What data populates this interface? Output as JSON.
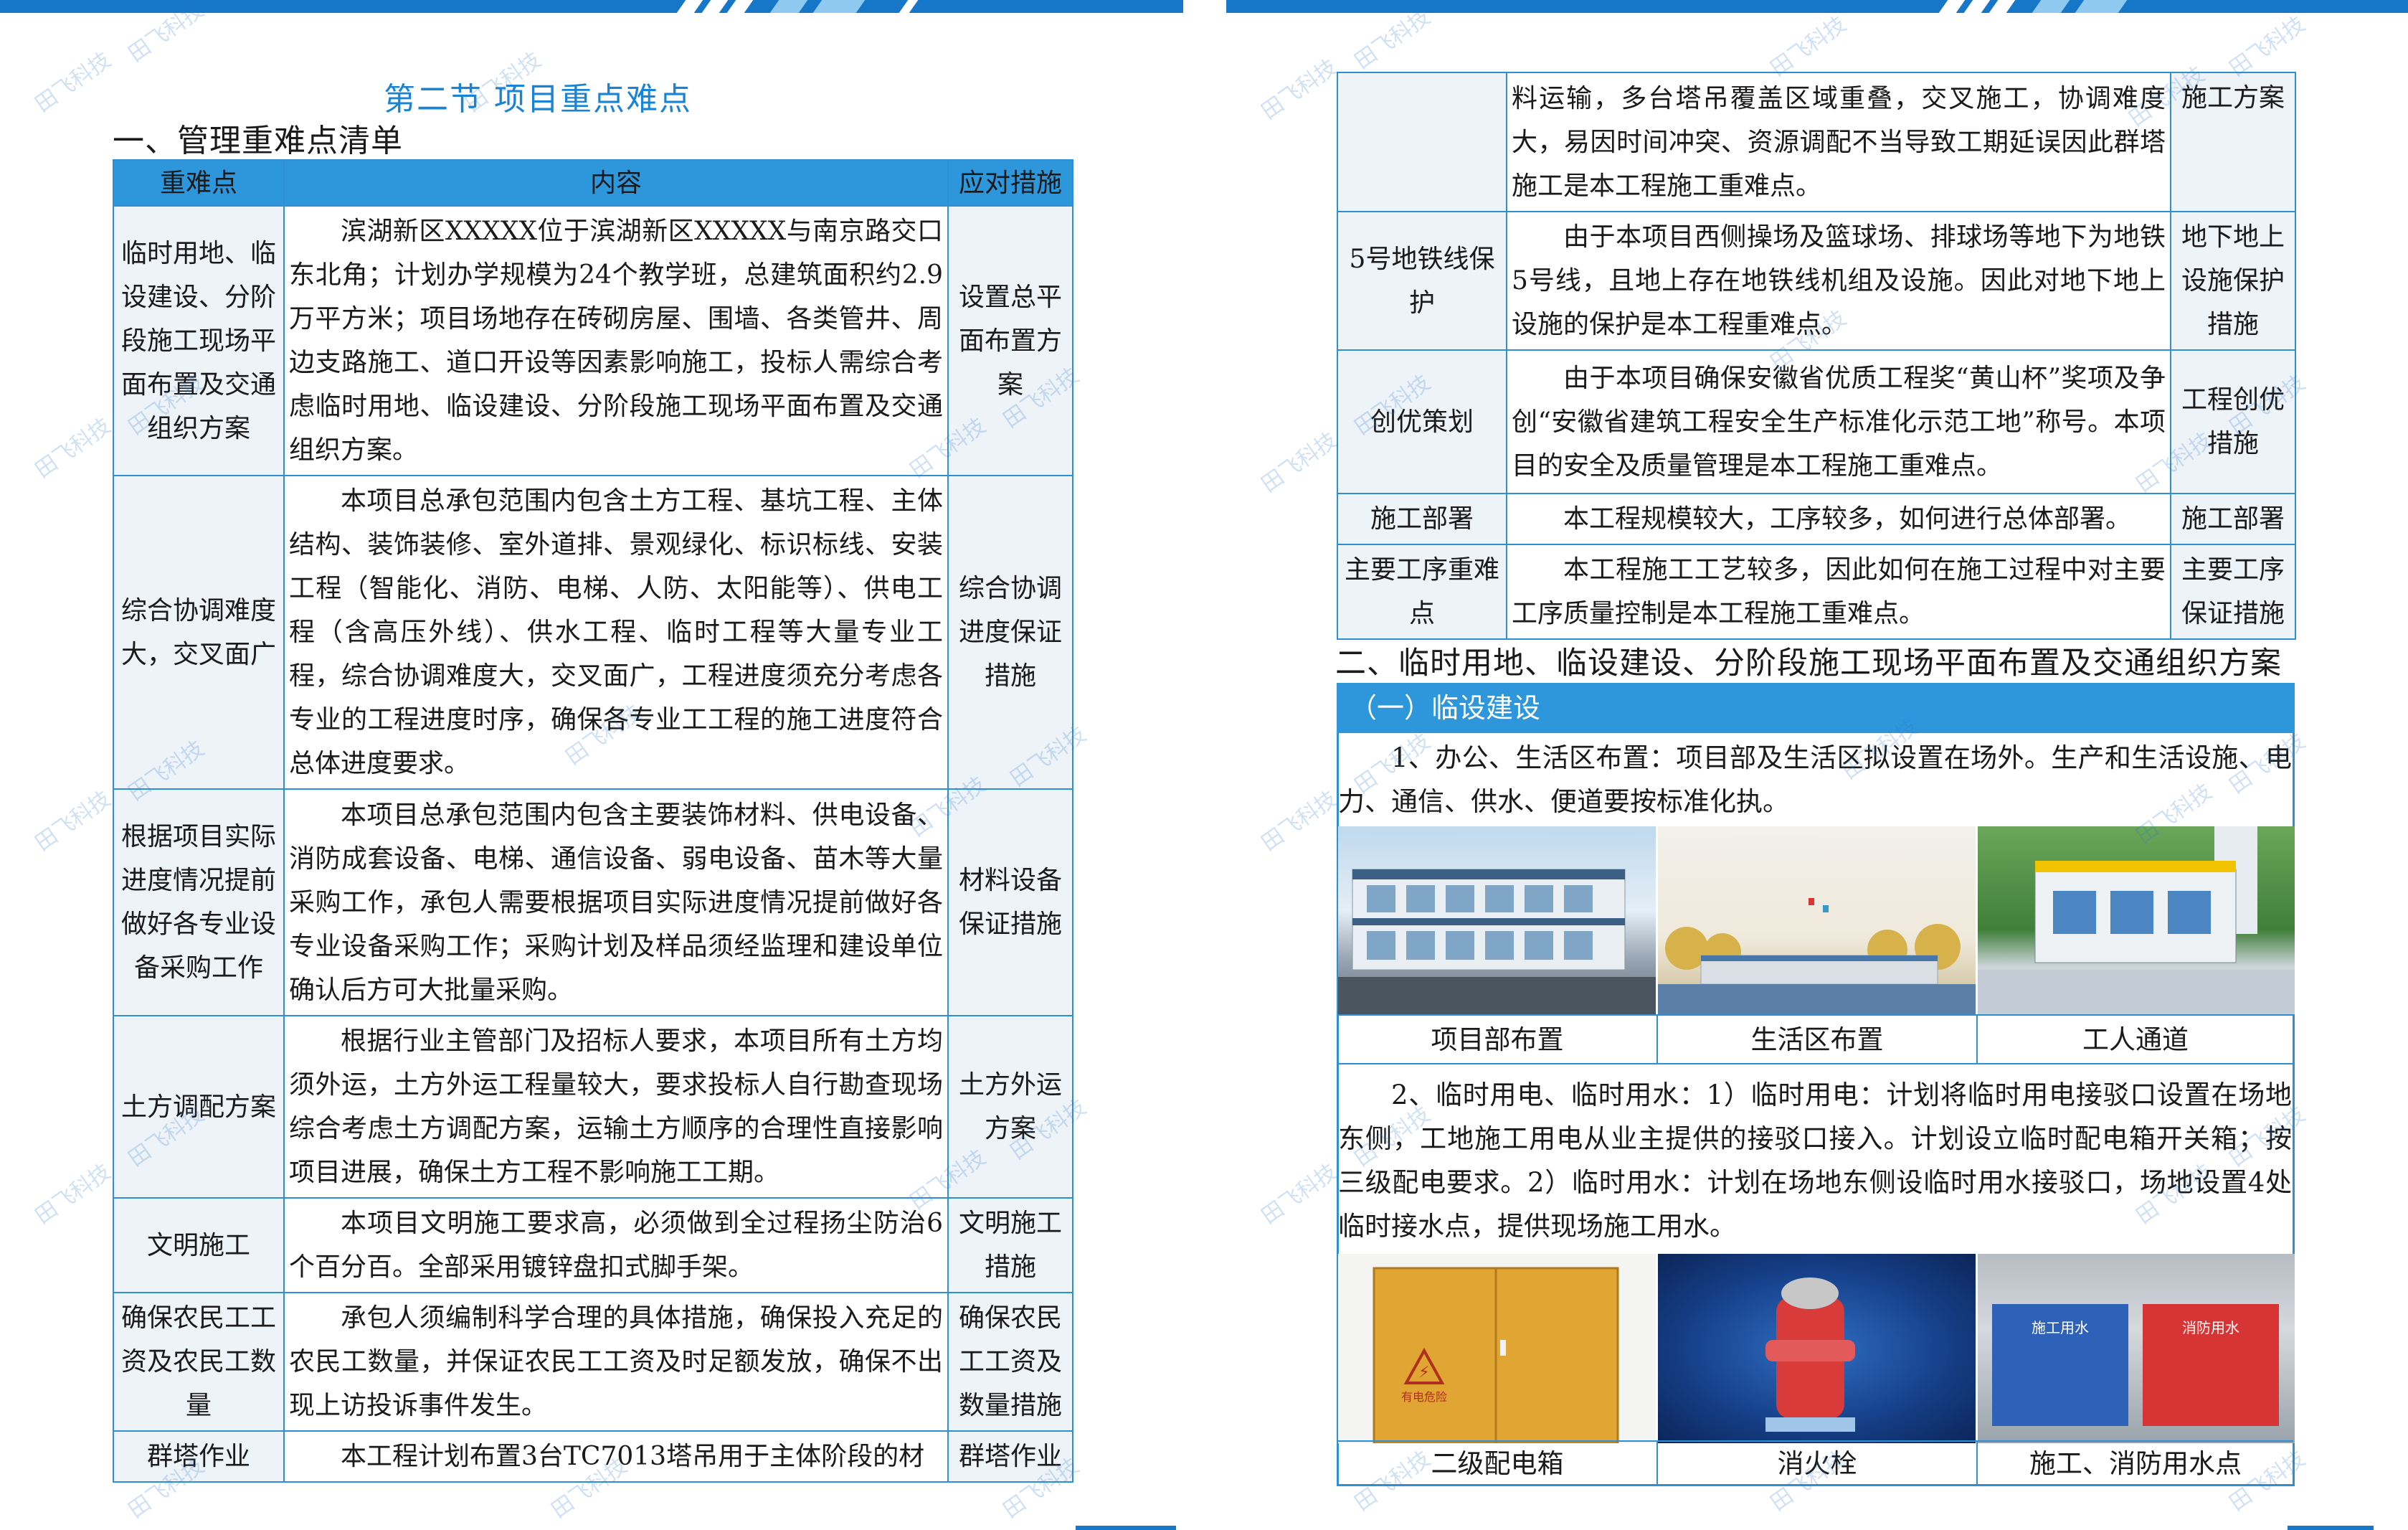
{
  "left_page": {
    "section_title": "第二节 项目重点难点",
    "heading": "一、管理重难点清单",
    "table": {
      "headers": [
        "重难点",
        "内容",
        "应对措施"
      ],
      "rows": [
        {
          "point": "临时用地、临设建设、分阶段施工现场平面布置及交通组织方案",
          "content": "滨湖新区XXXXX位于滨湖新区XXXXX与南京路交口东北角；计划办学规模为24个教学班，总建筑面积约2.9万平方米；项目场地存在砖砌房屋、围墙、各类管井、周边支路施工、道口开设等因素影响施工，投标人需综合考虑临时用地、临设建设、分阶段施工现场平面布置及交通组织方案。",
          "measure": "设置总平面布置方案"
        },
        {
          "point": "综合协调难度大，交叉面广",
          "content": "本项目总承包范围内包含土方工程、基坑工程、主体结构、装饰装修、室外道排、景观绿化、标识标线、安装工程（智能化、消防、电梯、人防、太阳能等）、供电工程（含高压外线）、供水工程、临时工程等大量专业工程，综合协调难度大，交叉面广，工程进度须充分考虑各专业的工程进度时序，确保各专业工工程的施工进度符合总体进度要求。",
          "measure": "综合协调进度保证措施"
        },
        {
          "point": "根据项目实际进度情况提前做好各专业设备采购工作",
          "content": "本项目总承包范围内包含主要装饰材料、供电设备、消防成套设备、电梯、通信设备、弱电设备、苗木等大量采购工作，承包人需要根据项目实际进度情况提前做好各专业设备采购工作；采购计划及样品须经监理和建设单位确认后方可大批量采购。",
          "measure": "材料设备保证措施"
        },
        {
          "point": "土方调配方案",
          "content": "根据行业主管部门及招标人要求，本项目所有土方均须外运，土方外运工程量较大，要求投标人自行勘查现场综合考虑土方调配方案，运输土方顺序的合理性直接影响项目进展，确保土方工程不影响施工工期。",
          "measure": "土方外运方案"
        },
        {
          "point": "文明施工",
          "content": "本项目文明施工要求高，必须做到全过程扬尘防治6个百分百。全部采用镀锌盘扣式脚手架。",
          "measure": "文明施工措施"
        },
        {
          "point": "确保农民工工资及农民工数量",
          "content": "承包人须编制科学合理的具体措施，确保投入充足的农民工数量，并保证农民工工资及时足额发放，确保不出现上访投诉事件发生。",
          "measure": "确保农民工工资及数量措施"
        },
        {
          "point": "群塔作业",
          "content": "本工程计划布置3台TC7013塔吊用于主体阶段的材",
          "measure": "群塔作业"
        }
      ]
    }
  },
  "right_page": {
    "table": {
      "rows": [
        {
          "point": "",
          "content": "料运输，多台塔吊覆盖区域重叠，交叉施工，协调难度大，易因时间冲突、资源调配不当导致工期延误因此群塔施工是本工程施工重难点。",
          "measure": "施工方案"
        },
        {
          "point": "5号地铁线保护",
          "content": "由于本项目西侧操场及篮球场、排球场等地下为地铁5号线，且地上存在地铁线机组及设施。因此对地下地上设施的保护是本工程重难点。",
          "measure": "地下地上设施保护措施"
        },
        {
          "point": "创优策划",
          "content": "由于本项目确保安徽省优质工程奖“黄山杯”奖项及争创“安徽省建筑工程安全生产标准化示范工地”称号。本项目的安全及质量管理是本工程施工重难点。",
          "measure": "工程创优措施"
        },
        {
          "point": "施工部署",
          "content": "本工程规模较大，工序较多，如何进行总体部署。",
          "measure": "施工部署"
        },
        {
          "point": "主要工序重难点",
          "content": "本工程施工工艺较多，因此如何在施工过程中对主要工序质量控制是本工程施工重难点。",
          "measure": "主要工序保证措施"
        }
      ]
    },
    "heading2": "二、临时用地、临设建设、分阶段施工现场平面布置及交通组织方案",
    "subsection": "（一）临设建设",
    "para1": "1、办公、生活区布置：项目部及生活区拟设置在场外。生产和生活设施、电力、通信、供水、便道要按标准化执。",
    "photos1": [
      "项目部布置",
      "生活区布置",
      "工人通道"
    ],
    "para2": "2、临时用电、临时用水：1）临时用电：计划将临时用电接驳口设置在场地东侧，工地施工用电从业主提供的接驳口接入。计划设立临时配电箱开关箱；按三级配电要求。2）临时用水：计划在场地东侧设临时用水接驳口，场地设置4处临时接水点，提供现场施工用水。",
    "photos2": [
      "二级配电箱",
      "消火栓",
      "施工、消防用水点"
    ],
    "box_label_1": "施工用水",
    "box_label_2": "消防用水",
    "cabinet_label": "有电危险"
  },
  "watermark": "田飞科技",
  "colors": {
    "accent": "#2e97dc",
    "border": "#2f8fd4",
    "title": "#1a84d4",
    "topbar": "#1677c8"
  }
}
